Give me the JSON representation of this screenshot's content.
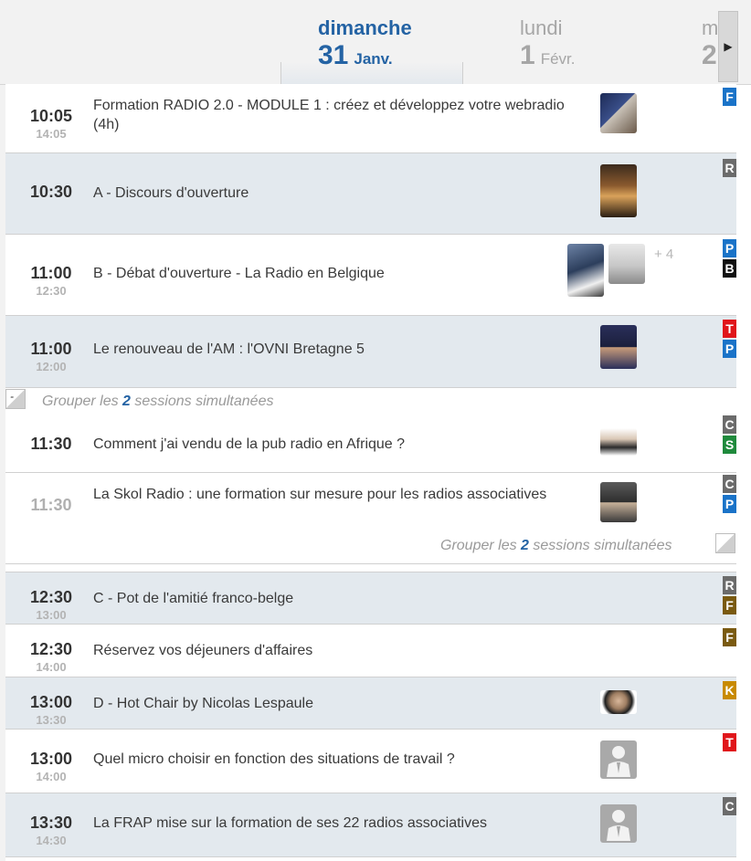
{
  "days": [
    {
      "name": "dimanche",
      "num": "31",
      "month": "Janv."
    },
    {
      "name": "lundi",
      "num": "1",
      "month": "Févr."
    },
    {
      "name": "m",
      "num": "2"
    }
  ],
  "next_icon": "▶",
  "group_labels": [
    {
      "prefix": "Grouper les ",
      "count": "2",
      "suffix": " sessions simultanées",
      "toggle": "-"
    },
    {
      "prefix": "Grouper les ",
      "count": "2",
      "suffix": " sessions simultanées"
    }
  ],
  "sessions": [
    {
      "start": "10:05",
      "end": "14:05",
      "title": "Formation RADIO 2.0 - MODULE 1 : créez et développez votre webradio (4h)",
      "tags": [
        "F"
      ]
    },
    {
      "start": "10:30",
      "end": "",
      "title": "A - Discours d'ouverture",
      "tags": [
        "R"
      ]
    },
    {
      "start": "11:00",
      "end": "12:30",
      "title": "B - Débat d'ouverture - La Radio en Belgique",
      "tags": [
        "P",
        "B"
      ],
      "plus": "+ 4"
    },
    {
      "start": "11:00",
      "end": "12:00",
      "title": "Le renouveau de l'AM : l'OVNI Bretagne 5",
      "tags": [
        "T",
        "P"
      ]
    },
    {
      "start": "11:30",
      "end": "",
      "title": "Comment j'ai vendu de la pub radio en Afrique ?",
      "tags": [
        "C",
        "S"
      ]
    },
    {
      "start": "11:30",
      "end": "",
      "title": "La Skol Radio : une formation sur mesure pour les radios associatives",
      "tags": [
        "C",
        "P"
      ]
    },
    {
      "start": "12:30",
      "end": "13:00",
      "title": "C - Pot de l'amitié franco-belge",
      "tags": [
        "R",
        "F"
      ]
    },
    {
      "start": "12:30",
      "end": "14:00",
      "title": "Réservez vos déjeuners d'affaires",
      "tags": [
        "F"
      ]
    },
    {
      "start": "13:00",
      "end": "13:30",
      "title": "D - Hot Chair by Nicolas Lespaule",
      "tags": [
        "K"
      ]
    },
    {
      "start": "13:00",
      "end": "14:00",
      "title": "Quel micro choisir en fonction des situations de travail ?",
      "tags": [
        "T"
      ]
    },
    {
      "start": "13:30",
      "end": "14:30",
      "title": "La FRAP mise sur la formation de ses 22 radios associatives",
      "tags": [
        "C"
      ]
    }
  ],
  "tag_colors": {
    "F_blue": "#1a73c8",
    "R": "#6b6b6b",
    "P": "#1a73c8",
    "B": "#111111",
    "T": "#e0161b",
    "C": "#6b6b6b",
    "S": "#1f8a3c",
    "F_brown": "#7a5a10",
    "K": "#c88a00"
  },
  "accent": "#2463a4"
}
